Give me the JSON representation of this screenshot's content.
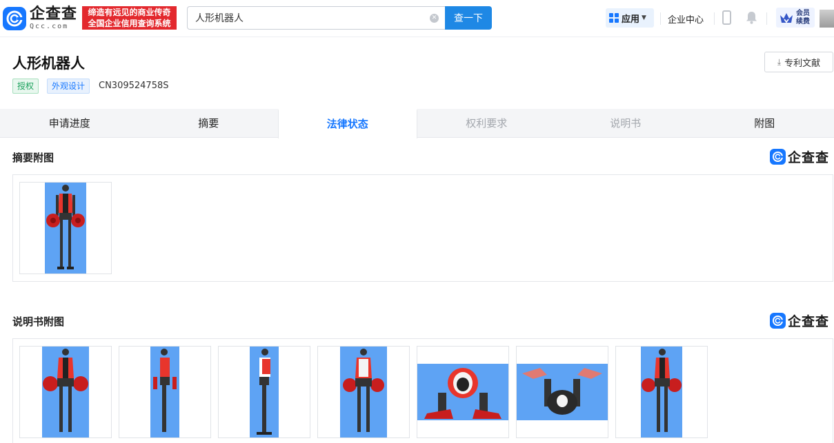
{
  "header": {
    "logo_cn": "企查查",
    "logo_en": "Qcc.com",
    "slogan_line1": "缔造有远见的商业传奇",
    "slogan_line2": "全国企业信用查询系统",
    "search_value": "人形机器人",
    "search_button": "查一下",
    "apps_label": "应用",
    "enterprise_center": "企业中心",
    "member_line1": "会员",
    "member_line2": "续费"
  },
  "patent": {
    "title": "人形机器人",
    "status_tag": "授权",
    "type_tag": "外观设计",
    "publication_no": "CN309524758S",
    "doc_button": "专利文献"
  },
  "tabs": [
    {
      "label": "申请进度",
      "state": "normal"
    },
    {
      "label": "摘要",
      "state": "normal"
    },
    {
      "label": "法律状态",
      "state": "active"
    },
    {
      "label": "权利要求",
      "state": "disabled"
    },
    {
      "label": "说明书",
      "state": "disabled"
    },
    {
      "label": "附图",
      "state": "normal"
    }
  ],
  "abstract_section": {
    "title": "摘要附图",
    "watermark": "企查查",
    "images": [
      {
        "view": "front"
      }
    ]
  },
  "spec_section": {
    "title": "说明书附图",
    "watermark": "企查查",
    "images": [
      {
        "view": "front"
      },
      {
        "view": "left"
      },
      {
        "view": "right"
      },
      {
        "view": "back"
      },
      {
        "view": "top"
      },
      {
        "view": "bottom"
      },
      {
        "view": "perspective"
      }
    ]
  },
  "colors": {
    "brand_blue": "#1677ff",
    "search_button": "#1e88e5",
    "slogan_red": "#e3292e",
    "image_background": "#5ea3f4",
    "vest_red": "#e8352c"
  }
}
